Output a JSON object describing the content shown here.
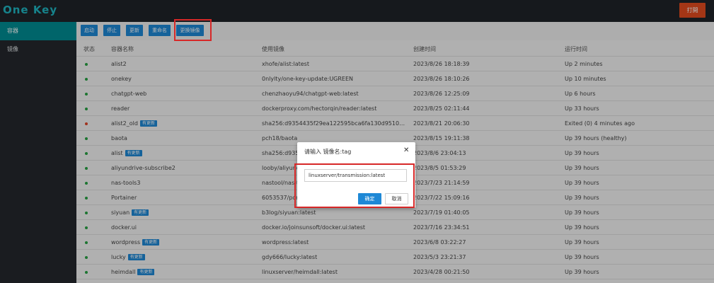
{
  "app": {
    "logo": "One Key",
    "open_button": "打開"
  },
  "sidebar": {
    "items": [
      {
        "label": "容器"
      },
      {
        "label": "镜像"
      }
    ]
  },
  "toolbar": {
    "buttons": [
      {
        "label": "启动"
      },
      {
        "label": "停止"
      },
      {
        "label": "更新"
      },
      {
        "label": "重命名"
      },
      {
        "label": "更换镜像"
      }
    ]
  },
  "table": {
    "headers": {
      "status": "状态",
      "name": "容器名称",
      "image": "使用镜像",
      "created": "创建时间",
      "run": "运行时间"
    },
    "rows": [
      {
        "name": "alist2",
        "badge": "",
        "image": "xhofe/alist:latest",
        "created": "2023/8/26 18:18:39",
        "run": "Up 2 minutes",
        "status_color": "#27a243"
      },
      {
        "name": "onekey",
        "badge": "",
        "image": "0nlylty/one-key-update:UGREEN",
        "created": "2023/8/26 18:10:26",
        "run": "Up 10 minutes",
        "status_color": "#27a243"
      },
      {
        "name": "chatgpt-web",
        "badge": "",
        "image": "chenzhaoyu94/chatgpt-web:latest",
        "created": "2023/8/26 12:25:09",
        "run": "Up 6 hours",
        "status_color": "#27a243"
      },
      {
        "name": "reader",
        "badge": "",
        "image": "dockerproxy.com/hectorqin/reader:latest",
        "created": "2023/8/25 02:11:44",
        "run": "Up 33 hours",
        "status_color": "#27a243"
      },
      {
        "name": "alist2_old",
        "badge": "有更新",
        "image": "sha256:d9354435f29ea122595bca6fa130d95100bafdb0...",
        "created": "2023/8/21 20:06:30",
        "run": "Exited (0) 4 minutes ago",
        "status_color": "#e0472a"
      },
      {
        "name": "baota",
        "badge": "",
        "image": "pch18/baota",
        "created": "2023/8/15 19:11:38",
        "run": "Up 39 hours (healthy)",
        "status_color": "#27a243"
      },
      {
        "name": "alist",
        "badge": "有更新",
        "image": "sha256:d9354",
        "created": "2023/8/6 23:04:13",
        "run": "Up 39 hours",
        "status_color": "#27a243"
      },
      {
        "name": "aliyundrive-subscribe2",
        "badge": "",
        "image": "looby/aliyund",
        "created": "2023/8/5 01:53:29",
        "run": "Up 39 hours",
        "status_color": "#27a243"
      },
      {
        "name": "nas-tools3",
        "badge": "",
        "image": "nastool/nas-to",
        "created": "2023/7/23 21:14:59",
        "run": "Up 39 hours",
        "status_color": "#27a243"
      },
      {
        "name": "Portainer",
        "badge": "",
        "image": "6053537/porta",
        "created": "2023/7/22 15:09:16",
        "run": "Up 39 hours",
        "status_color": "#27a243"
      },
      {
        "name": "siyuan",
        "badge": "有更新",
        "image": "b3log/siyuan:latest",
        "created": "2023/7/19 01:40:05",
        "run": "Up 39 hours",
        "status_color": "#27a243"
      },
      {
        "name": "docker.ui",
        "badge": "",
        "image": "docker.io/joinsunsoft/docker.ui:latest",
        "created": "2023/7/16 23:34:51",
        "run": "Up 39 hours",
        "status_color": "#27a243"
      },
      {
        "name": "wordpress",
        "badge": "有更新",
        "image": "wordpress:latest",
        "created": "2023/6/8 03:22:27",
        "run": "Up 39 hours",
        "status_color": "#27a243"
      },
      {
        "name": "lucky",
        "badge": "有更新",
        "image": "gdy666/lucky:latest",
        "created": "2023/5/3 23:21:37",
        "run": "Up 39 hours",
        "status_color": "#27a243"
      },
      {
        "name": "heimdall",
        "badge": "有更新",
        "image": "linuxserver/heimdall:latest",
        "created": "2023/4/28 00:21:50",
        "run": "Up 39 hours",
        "status_color": "#27a243"
      }
    ]
  },
  "dialog": {
    "title": "请输入 镜像名:tag",
    "input_value": "linuxserver/transmission:latest",
    "ok": "确定",
    "cancel": "取消"
  },
  "colors": {
    "highlight": "#d72828",
    "accent": "#1e88d6",
    "sidebar_active": "#008d94"
  }
}
